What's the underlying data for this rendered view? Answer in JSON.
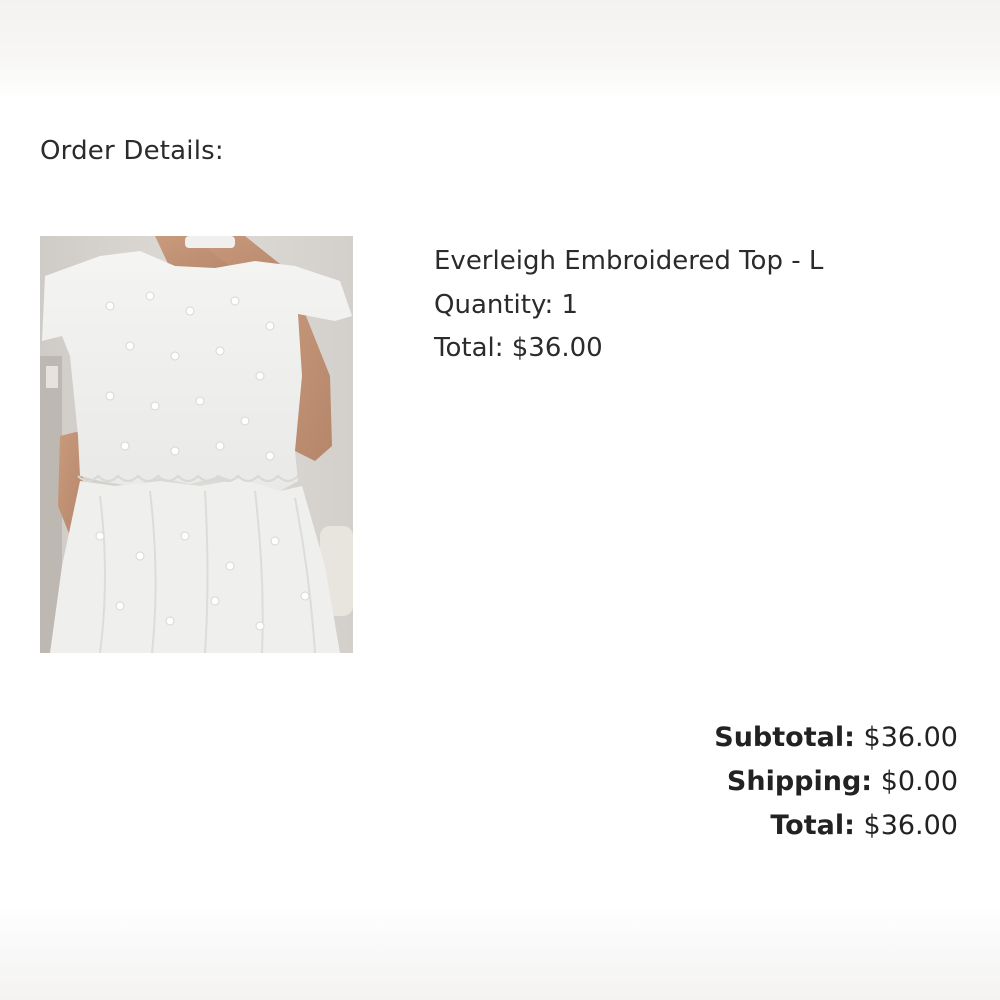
{
  "order": {
    "heading": "Order Details:"
  },
  "item": {
    "image_alt": "Everleigh Embroidered Top product photo",
    "name_line": "Everleigh Embroidered Top - L",
    "quantity_label": "Quantity:",
    "quantity_value": "1",
    "total_label": "Total:",
    "total_value": "$36.00"
  },
  "summary": {
    "subtotal_label": "Subtotal",
    "subtotal_value": "$36.00",
    "shipping_label": "Shipping",
    "shipping_value": "$0.00",
    "total_label": "Total",
    "total_value": "$36.00"
  }
}
